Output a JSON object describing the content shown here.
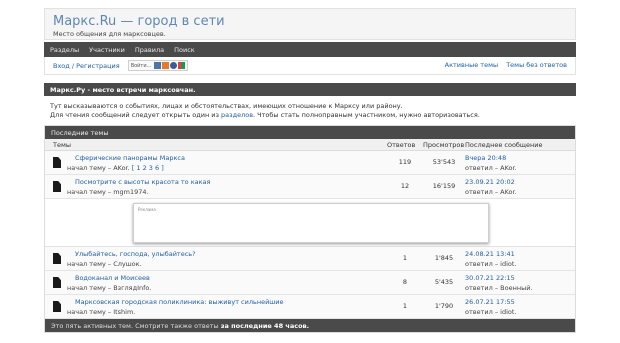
{
  "brand": {
    "title": "Маркс.Ru — город в сети",
    "description": "Место общения для марксовцев."
  },
  "nav": {
    "items": [
      "Разделы",
      "Участники",
      "Правила",
      "Поиск"
    ]
  },
  "user": {
    "login_text": "Вход / Регистрация",
    "social_label": "Войти...",
    "social_icons": [
      "vk-icon",
      "mailru-icon",
      "at-icon",
      "google-icon"
    ],
    "quick_links": [
      "Активные темы",
      "Темы без ответов"
    ]
  },
  "welcome": {
    "title": "Маркс.Ру - место встречи марксовчан.",
    "line1": "Тут высказываются о событиях, лицах и обстоятельствах, имеющих отношение к Марксу или району.",
    "line2_before": "Для чтения сообщений следует открыть один из ",
    "line2_link": "разделов",
    "line2_after": ". Чтобы стать полноправным участником, нужно авторизоваться."
  },
  "topics": {
    "header": "Последние темы",
    "columns": {
      "topic": "Темы",
      "replies": "Ответов",
      "views": "Просмотров",
      "last": "Последнее сообщение"
    },
    "rows": [
      {
        "title": "Сферические панорамы Маркса",
        "starter": "начал тему – AKor.",
        "pages": "[ 1 2 3 6 ]",
        "replies": "119",
        "views": "53'543",
        "last_date": "Вчера 20:48",
        "last_by": "ответил – AKor."
      },
      {
        "title": "Посмотрите с высоты красота то какая",
        "starter": "начал тему – mgm1974.",
        "pages": "",
        "replies": "12",
        "views": "16'159",
        "last_date": "23.09.21 20:02",
        "last_by": "ответил – AKor."
      },
      {
        "title": "Улыбайтесь, господа, улыбайтесь?",
        "starter": "начал тему – Слушок.",
        "pages": "",
        "replies": "1",
        "views": "1'845",
        "last_date": "24.08.21 13:41",
        "last_by": "ответил – idiot."
      },
      {
        "title": "Водоканал и Моисеев",
        "starter": "начал тему – ВзглядInfo.",
        "pages": "",
        "replies": "8",
        "views": "5'435",
        "last_date": "30.07.21 22:15",
        "last_by": "ответил – Военный."
      },
      {
        "title": "Марксовская городская поликлиника: выживут сильнейшие",
        "starter": "начал тему – Itshim.",
        "pages": "",
        "replies": "1",
        "views": "1'790",
        "last_date": "26.07.21 17:55",
        "last_by": "ответил – idiot."
      }
    ],
    "ad_label": "Реклама"
  },
  "footer": {
    "text": "Это пять активных тем. Смотрите также ответы ",
    "bold": "за последние 48 часов."
  }
}
